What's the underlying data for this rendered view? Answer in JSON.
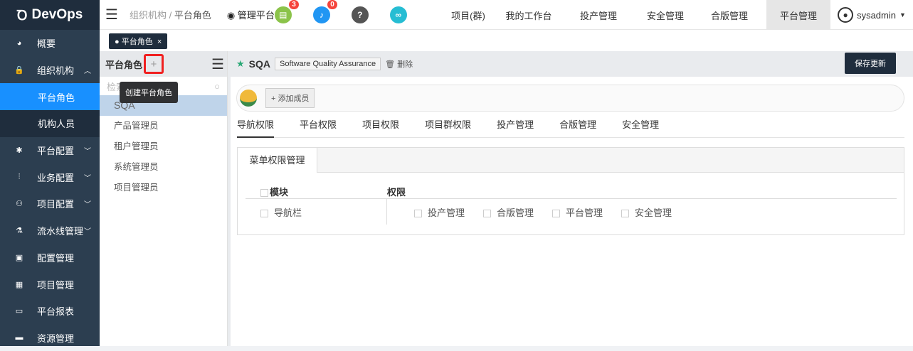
{
  "app": {
    "logo": "DevOps"
  },
  "sidebar": {
    "items": [
      {
        "label": "概要",
        "icon": "dashboard-icon"
      },
      {
        "label": "组织机构",
        "icon": "lock-icon",
        "expanded": true
      },
      {
        "label": "平台角色",
        "sub": true,
        "active": true
      },
      {
        "label": "机构人员",
        "sub": true
      },
      {
        "label": "平台配置",
        "icon": "gear-icon"
      },
      {
        "label": "业务配置",
        "icon": "sliders-icon"
      },
      {
        "label": "项目配置",
        "icon": "project-icon"
      },
      {
        "label": "流水线管理",
        "icon": "pipeline-icon"
      },
      {
        "label": "配置管理",
        "icon": "database-icon"
      },
      {
        "label": "项目管理",
        "icon": "grid-icon"
      },
      {
        "label": "平台报表",
        "icon": "monitor-icon"
      },
      {
        "label": "资源管理",
        "icon": "folder-icon"
      }
    ]
  },
  "header": {
    "breadcrumb": [
      "组织机构",
      "平台角色"
    ],
    "sep": "/",
    "mgmt": "管理平台",
    "doc_badge": "3",
    "bell_badge": "0",
    "nav": [
      "项目(群)",
      "我的工作台",
      "投产管理",
      "安全管理",
      "合版管理",
      "平台管理"
    ],
    "active_nav": "平台管理",
    "user": "sysadmin"
  },
  "page_tab": {
    "label": "平台角色",
    "close": "×"
  },
  "left": {
    "title": "平台角色",
    "search_placeholder": "检索",
    "tooltip": "创建平台角色",
    "roles": [
      "SQA",
      "产品管理员",
      "租户管理员",
      "系统管理员",
      "项目管理员"
    ]
  },
  "right": {
    "role_name": "SQA",
    "role_desc": "Software Quality Assurance",
    "delete": "删除",
    "save": "保存更新",
    "add_member": "添加成员",
    "tabs": [
      "导航权限",
      "平台权限",
      "项目权限",
      "项目群权限",
      "投产管理",
      "合版管理",
      "安全管理"
    ],
    "subtab": "菜单权限管理",
    "col_module": "模块",
    "col_perm": "权限",
    "module": "导航栏",
    "perms": [
      "投产管理",
      "合版管理",
      "平台管理",
      "安全管理"
    ]
  },
  "colors": {
    "sidebar": "#2c3e50",
    "active": "#1890ff",
    "accent": "#f02020"
  }
}
